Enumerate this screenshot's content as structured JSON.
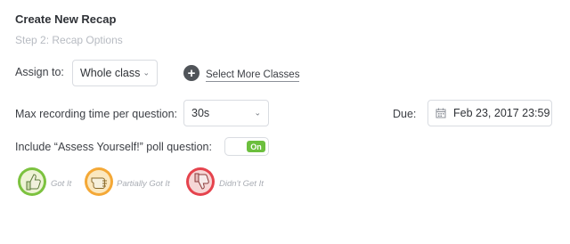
{
  "header": {
    "title": "Create New Recap",
    "step": "Step 2: Recap Options"
  },
  "assign": {
    "label": "Assign to:",
    "selected": "Whole class",
    "add_label": "Select More Classes"
  },
  "recording": {
    "label": "Max recording time per question:",
    "selected": "30s"
  },
  "due": {
    "label": "Due:",
    "value": "Feb 23, 2017 23:59"
  },
  "poll": {
    "label": "Include “Assess Yourself!” poll question:",
    "toggle_label": "On",
    "enabled": true
  },
  "assessment": {
    "options": [
      {
        "label": "Got It",
        "color": "#7cc23f",
        "icon": "thumbs-up-icon"
      },
      {
        "label": "Partially Got It",
        "color": "#f4a836",
        "icon": "thumbs-sideways-icon"
      },
      {
        "label": "Didn't Get It",
        "color": "#e5434d",
        "icon": "thumbs-down-icon"
      }
    ]
  }
}
